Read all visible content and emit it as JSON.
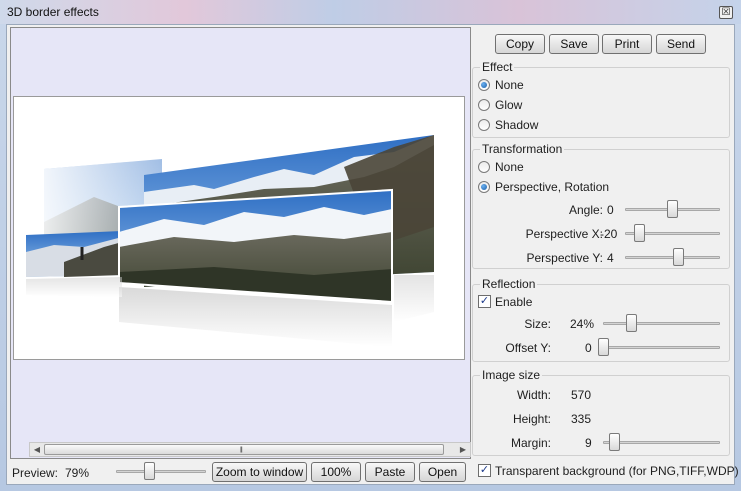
{
  "window": {
    "title": "3D border effects",
    "close_glyph": "☒"
  },
  "toolbar": {
    "copy": "Copy",
    "save": "Save",
    "print": "Print",
    "send": "Send"
  },
  "effect": {
    "title": "Effect",
    "options": [
      "None",
      "Glow",
      "Shadow"
    ],
    "selected": "None"
  },
  "transformation": {
    "title": "Transformation",
    "options": [
      "None",
      "Perspective, Rotation"
    ],
    "selected": "Perspective, Rotation",
    "angle_label": "Angle:",
    "angle_value": "0",
    "angle_level": 0.5,
    "perspx_label": "Perspective X:",
    "perspx_value": "-20",
    "perspx_level": 0.1,
    "perspy_label": "Perspective Y:",
    "perspy_value": "4",
    "perspy_level": 0.55
  },
  "reflection": {
    "title": "Reflection",
    "enable_label": "Enable",
    "enabled": true,
    "size_label": "Size:",
    "size_value": "24%",
    "size_level": 0.24,
    "offset_label": "Offset Y:",
    "offset_value": "0",
    "offset_level": 0.0
  },
  "image_size": {
    "title": "Image size",
    "width_label": "Width:",
    "width_value": "570",
    "height_label": "Height:",
    "height_value": "335",
    "margin_label": "Margin:",
    "margin_value": "9",
    "margin_level": 0.09
  },
  "transparent_bg": {
    "label": "Transparent background (for PNG,TIFF,WDP)",
    "checked": true
  },
  "bottom": {
    "preview_label": "Preview:",
    "preview_value": "79%",
    "preview_level": 0.33,
    "zoom_to_window": "Zoom to window",
    "zoom_100": "100%",
    "paste": "Paste",
    "open": "Open"
  },
  "colors": {
    "preview_bg": "#e6e6f7",
    "radio_fill": "#1c5fa8",
    "sky": "#3f7fd0"
  }
}
